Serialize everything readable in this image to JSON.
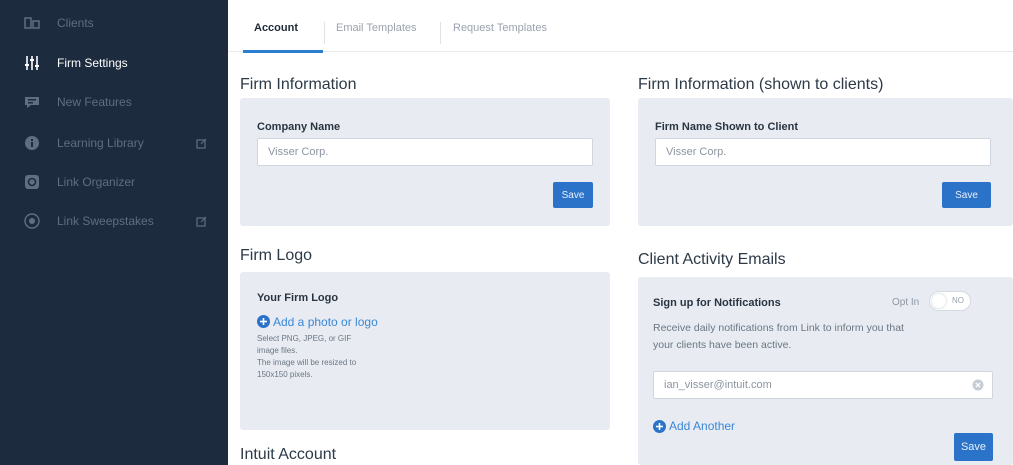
{
  "sidebar": {
    "items": [
      {
        "label": "Clients",
        "icon": "clients-icon",
        "active": false,
        "external": false
      },
      {
        "label": "Firm Settings",
        "icon": "settings-sliders-icon",
        "active": true,
        "external": false
      },
      {
        "label": "New Features",
        "icon": "megaphone-icon",
        "active": false,
        "external": false
      },
      {
        "label": "Learning Library",
        "icon": "info-icon",
        "active": false,
        "external": true
      },
      {
        "label": "Link Organizer",
        "icon": "organizer-icon",
        "active": false,
        "external": false
      },
      {
        "label": "Link Sweepstakes",
        "icon": "sweepstakes-icon",
        "active": false,
        "external": true
      }
    ]
  },
  "tabs": [
    {
      "label": "Account",
      "active": true
    },
    {
      "label": "Email Templates",
      "active": false
    },
    {
      "label": "Request Templates",
      "active": false
    }
  ],
  "firm_info": {
    "title": "Firm Information",
    "label": "Company Name",
    "value": "Visser Corp.",
    "save": "Save"
  },
  "firm_info_clients": {
    "title": "Firm Information (shown to clients)",
    "label": "Firm Name Shown to Client",
    "value": "Visser Corp.",
    "save": "Save"
  },
  "firm_logo": {
    "title": "Firm Logo",
    "label": "Your Firm Logo",
    "add_link": "Add a photo or logo",
    "help_line1": "Select PNG, JPEG, or GIF",
    "help_line2": "image files.",
    "help_line3": "The image will be resized to",
    "help_line4": "150x150 pixels."
  },
  "intuit_account": {
    "title": "Intuit Account"
  },
  "activity_emails": {
    "title": "Client Activity Emails",
    "label": "Sign up for Notifications",
    "optin_label": "Opt In",
    "toggle_state": "NO",
    "description_line1": "Receive daily notifications from Link to inform you that",
    "description_line2": "your clients have been active.",
    "email_value": "ian_visser@intuit.com",
    "add_another": "Add Another",
    "save": "Save"
  },
  "colors": {
    "sidebar_bg": "#1d2b3f",
    "accent": "#2b73c9",
    "card_bg": "#e8ecf2"
  }
}
